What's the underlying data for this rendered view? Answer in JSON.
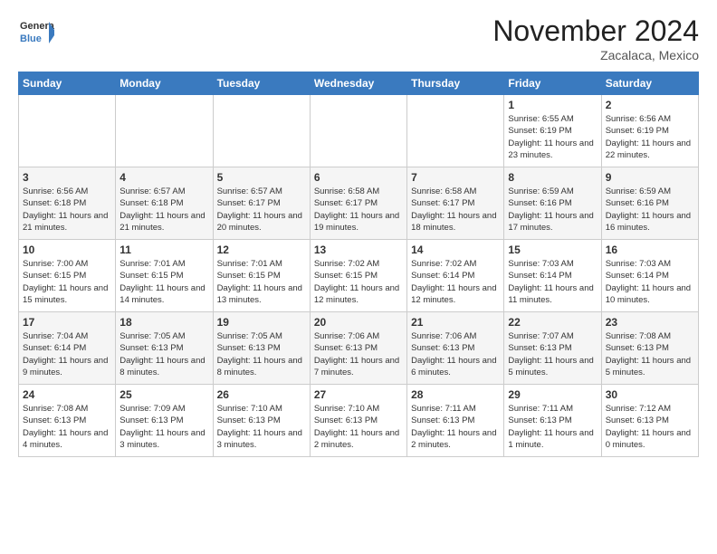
{
  "logo": {
    "general": "General",
    "blue": "Blue"
  },
  "header": {
    "month": "November 2024",
    "location": "Zacalaca, Mexico"
  },
  "weekdays": [
    "Sunday",
    "Monday",
    "Tuesday",
    "Wednesday",
    "Thursday",
    "Friday",
    "Saturday"
  ],
  "weeks": [
    [
      {
        "day": "",
        "info": ""
      },
      {
        "day": "",
        "info": ""
      },
      {
        "day": "",
        "info": ""
      },
      {
        "day": "",
        "info": ""
      },
      {
        "day": "",
        "info": ""
      },
      {
        "day": "1",
        "info": "Sunrise: 6:55 AM\nSunset: 6:19 PM\nDaylight: 11 hours and 23 minutes."
      },
      {
        "day": "2",
        "info": "Sunrise: 6:56 AM\nSunset: 6:19 PM\nDaylight: 11 hours and 22 minutes."
      }
    ],
    [
      {
        "day": "3",
        "info": "Sunrise: 6:56 AM\nSunset: 6:18 PM\nDaylight: 11 hours and 21 minutes."
      },
      {
        "day": "4",
        "info": "Sunrise: 6:57 AM\nSunset: 6:18 PM\nDaylight: 11 hours and 21 minutes."
      },
      {
        "day": "5",
        "info": "Sunrise: 6:57 AM\nSunset: 6:17 PM\nDaylight: 11 hours and 20 minutes."
      },
      {
        "day": "6",
        "info": "Sunrise: 6:58 AM\nSunset: 6:17 PM\nDaylight: 11 hours and 19 minutes."
      },
      {
        "day": "7",
        "info": "Sunrise: 6:58 AM\nSunset: 6:17 PM\nDaylight: 11 hours and 18 minutes."
      },
      {
        "day": "8",
        "info": "Sunrise: 6:59 AM\nSunset: 6:16 PM\nDaylight: 11 hours and 17 minutes."
      },
      {
        "day": "9",
        "info": "Sunrise: 6:59 AM\nSunset: 6:16 PM\nDaylight: 11 hours and 16 minutes."
      }
    ],
    [
      {
        "day": "10",
        "info": "Sunrise: 7:00 AM\nSunset: 6:15 PM\nDaylight: 11 hours and 15 minutes."
      },
      {
        "day": "11",
        "info": "Sunrise: 7:01 AM\nSunset: 6:15 PM\nDaylight: 11 hours and 14 minutes."
      },
      {
        "day": "12",
        "info": "Sunrise: 7:01 AM\nSunset: 6:15 PM\nDaylight: 11 hours and 13 minutes."
      },
      {
        "day": "13",
        "info": "Sunrise: 7:02 AM\nSunset: 6:15 PM\nDaylight: 11 hours and 12 minutes."
      },
      {
        "day": "14",
        "info": "Sunrise: 7:02 AM\nSunset: 6:14 PM\nDaylight: 11 hours and 12 minutes."
      },
      {
        "day": "15",
        "info": "Sunrise: 7:03 AM\nSunset: 6:14 PM\nDaylight: 11 hours and 11 minutes."
      },
      {
        "day": "16",
        "info": "Sunrise: 7:03 AM\nSunset: 6:14 PM\nDaylight: 11 hours and 10 minutes."
      }
    ],
    [
      {
        "day": "17",
        "info": "Sunrise: 7:04 AM\nSunset: 6:14 PM\nDaylight: 11 hours and 9 minutes."
      },
      {
        "day": "18",
        "info": "Sunrise: 7:05 AM\nSunset: 6:13 PM\nDaylight: 11 hours and 8 minutes."
      },
      {
        "day": "19",
        "info": "Sunrise: 7:05 AM\nSunset: 6:13 PM\nDaylight: 11 hours and 8 minutes."
      },
      {
        "day": "20",
        "info": "Sunrise: 7:06 AM\nSunset: 6:13 PM\nDaylight: 11 hours and 7 minutes."
      },
      {
        "day": "21",
        "info": "Sunrise: 7:06 AM\nSunset: 6:13 PM\nDaylight: 11 hours and 6 minutes."
      },
      {
        "day": "22",
        "info": "Sunrise: 7:07 AM\nSunset: 6:13 PM\nDaylight: 11 hours and 5 minutes."
      },
      {
        "day": "23",
        "info": "Sunrise: 7:08 AM\nSunset: 6:13 PM\nDaylight: 11 hours and 5 minutes."
      }
    ],
    [
      {
        "day": "24",
        "info": "Sunrise: 7:08 AM\nSunset: 6:13 PM\nDaylight: 11 hours and 4 minutes."
      },
      {
        "day": "25",
        "info": "Sunrise: 7:09 AM\nSunset: 6:13 PM\nDaylight: 11 hours and 3 minutes."
      },
      {
        "day": "26",
        "info": "Sunrise: 7:10 AM\nSunset: 6:13 PM\nDaylight: 11 hours and 3 minutes."
      },
      {
        "day": "27",
        "info": "Sunrise: 7:10 AM\nSunset: 6:13 PM\nDaylight: 11 hours and 2 minutes."
      },
      {
        "day": "28",
        "info": "Sunrise: 7:11 AM\nSunset: 6:13 PM\nDaylight: 11 hours and 2 minutes."
      },
      {
        "day": "29",
        "info": "Sunrise: 7:11 AM\nSunset: 6:13 PM\nDaylight: 11 hours and 1 minute."
      },
      {
        "day": "30",
        "info": "Sunrise: 7:12 AM\nSunset: 6:13 PM\nDaylight: 11 hours and 0 minutes."
      }
    ]
  ]
}
